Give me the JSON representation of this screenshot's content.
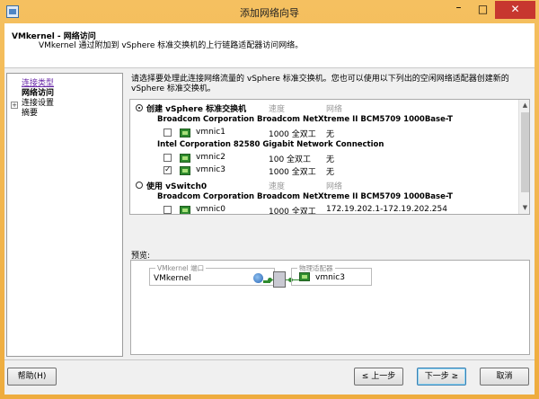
{
  "window": {
    "title": "添加网络向导",
    "minimize_label": "–",
    "maximize_label": "□",
    "close_label": "✕"
  },
  "header": {
    "title": "VMkernel - 网络访问",
    "subtitle": "VMkernel 通过附加到 vSphere 标准交换机的上行链路适配器访问网络。"
  },
  "nav": {
    "items": [
      {
        "label": "连接类型"
      },
      {
        "label": "网络访问"
      },
      {
        "label": "连接设置"
      },
      {
        "label": "摘要"
      }
    ],
    "expander": "+"
  },
  "main": {
    "instruction": "请选择要处理此连接网络流量的 vSphere 标准交换机。您也可以使用以下列出的空闲网络适配器创建新的 vSphere 标准交换机。",
    "create_switch": {
      "label": "创建 vSphere 标准交换机",
      "speed_header": "速度",
      "network_header": "网络",
      "selected": true
    },
    "adapter_groups": [
      {
        "name": "Broadcom Corporation Broadcom NetXtreme II BCM5709 1000Base-T"
      },
      {
        "name": "Intel Corporation 82580 Gigabit Network Connection"
      }
    ],
    "nics_new": [
      {
        "name": "vmnic1",
        "speed": "1000 全双工",
        "network": "无",
        "checked": false
      },
      {
        "name": "vmnic2",
        "speed": "100 全双工",
        "network": "无",
        "checked": false
      },
      {
        "name": "vmnic3",
        "speed": "1000 全双工",
        "network": "无",
        "checked": true
      }
    ],
    "use_switch": {
      "label": "使用 vSwitch0",
      "speed_header": "速度",
      "network_header": "网络",
      "selected": false,
      "adapter": "Broadcom Corporation Broadcom NetXtreme II BCM5709 1000Base-T",
      "nic": {
        "name": "vmnic0",
        "speed": "1000 全双工",
        "network": "172.19.202.1-172.19.202.254",
        "checked": false
      }
    },
    "checkmark": "✓",
    "scroll_up": "▲",
    "scroll_down": "▼"
  },
  "preview": {
    "label": "预览:",
    "vmkernel_group": "VMkernel 端口",
    "vmkernel_name": "VMkernel",
    "adapter_group": "物理适配器",
    "adapter_name": "vmnic3"
  },
  "buttons": {
    "help": "帮助(H)",
    "back": "≤ 上一步",
    "next": "下一步 ≥",
    "cancel": "取消"
  }
}
